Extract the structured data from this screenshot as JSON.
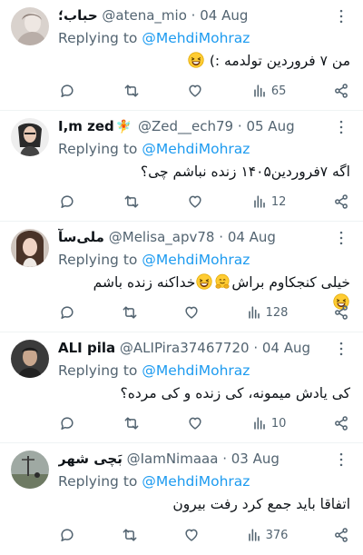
{
  "colors": {
    "accent": "#1d9bf0",
    "muted": "#536471",
    "text": "#0f1419",
    "divider": "#eff3f4"
  },
  "tweets": [
    {
      "name": "حباب؛",
      "handle": "@atena_mio",
      "sep": "·",
      "date": "04 Aug",
      "replying_prefix": "Replying to",
      "replying_handle": "@MehdiMohraz",
      "text": "من ۷ فروردین تولدمه :)",
      "emojis": [
        "grinning-squint-face"
      ],
      "views": "65",
      "icons": [
        "comment-icon",
        "retweet-icon",
        "like-icon",
        "views-icon",
        "share-icon"
      ]
    },
    {
      "name": "I,m zed",
      "name_badge": "fairy-emoji",
      "handle": "@Zed__ech79",
      "sep": "·",
      "date": "05 Aug",
      "replying_prefix": "Replying to",
      "replying_handle": "@MehdiMohraz",
      "text": "اگه ۷فروردین۱۴۰۵ زنده نباشم چی؟",
      "views": "12"
    },
    {
      "name": "ملی‌سآ",
      "handle": "@Melisa_apv78",
      "sep": "·",
      "date": "04 Aug",
      "replying_prefix": "Replying to",
      "replying_handle": "@MehdiMohraz",
      "text_part1": "خیلی کنجکاوم براش",
      "text_part2": "خداکنه زنده باشم",
      "emojis": [
        "hugging-face",
        "grinning-squint-face",
        "grinning-squint-face"
      ],
      "views": "128"
    },
    {
      "name": "ALI pila",
      "handle": "@ALIPira37467720",
      "sep": "·",
      "date": "04 Aug",
      "replying_prefix": "Replying to",
      "replying_handle": "@MehdiMohraz",
      "text": "کی یادش میمونه، کی زنده و کی مرده؟",
      "views": "10"
    },
    {
      "name": "بَچی شهر",
      "handle": "@IamNimaaa",
      "sep": "·",
      "date": "03 Aug",
      "replying_prefix": "Replying to",
      "replying_handle": "@MehdiMohraz",
      "text": "اتفاقا باید جمع کرد رفت بیرون",
      "views": "376"
    }
  ]
}
